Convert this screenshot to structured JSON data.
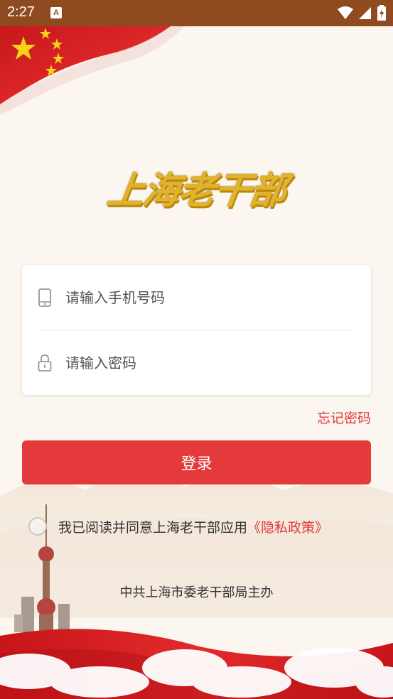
{
  "status_bar": {
    "time": "2:27",
    "notification_icon": "A",
    "icons": [
      "wifi-icon",
      "signal-icon",
      "battery-charging-icon"
    ]
  },
  "logo": {
    "text": "上海老干部"
  },
  "login": {
    "phone_placeholder": "请输入手机号码",
    "password_placeholder": "请输入密码",
    "forgot_password": "忘记密码",
    "login_button": "登录"
  },
  "agreement": {
    "text": "我已阅读并同意上海老干部应用",
    "policy_link": "《隐私政策》",
    "checked": false
  },
  "footer": {
    "text": "中共上海市委老干部局主办"
  },
  "colors": {
    "status_bar": "#8f4a1f",
    "primary_red": "#e53a3b",
    "link_red": "#e0393a",
    "logo_gold": "#e3b22b",
    "background": "#fbf6ef"
  }
}
